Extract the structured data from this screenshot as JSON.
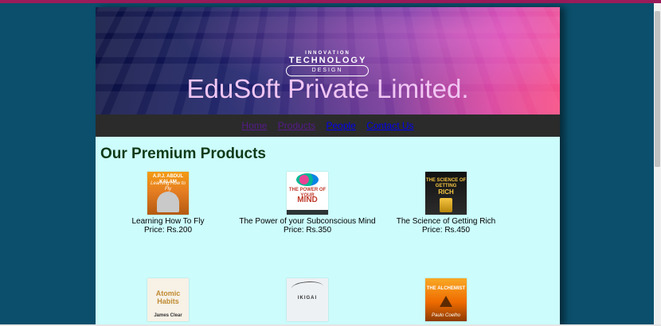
{
  "banner": {
    "small_text": "INNOVATION",
    "technology_text": "TECHNOLOGY",
    "design_text": "DESIGN",
    "title": "EduSoft Private Limited."
  },
  "nav": {
    "items": [
      {
        "label": "Home"
      },
      {
        "label": "Products"
      },
      {
        "label": "People"
      },
      {
        "label": "Contact Us"
      }
    ]
  },
  "section": {
    "heading": "Our Premium Products"
  },
  "products": [
    {
      "name": "Learning How To Fly",
      "price": "Price: Rs.200",
      "cover_title": "A.P.J. ABDUL KALAM",
      "cover_sub": "Learning How to Fly"
    },
    {
      "name": "The Power of your Subconscious Mind",
      "price": "Price: Rs.350",
      "cover_title": "THE POWER OF YOUR",
      "cover_sub": "MIND"
    },
    {
      "name": "The Science of Getting Rich",
      "price": "Price: Rs.450",
      "cover_title": "THE SCIENCE OF GETTING",
      "cover_sub": "RICH"
    },
    {
      "name": "",
      "price": "",
      "cover_title": "Atomic Habits",
      "cover_sub": "James Clear"
    },
    {
      "name": "",
      "price": "",
      "cover_title": "IKIGAI",
      "cover_sub": ""
    },
    {
      "name": "",
      "price": "",
      "cover_title": "THE ALCHEMIST",
      "cover_sub": "Paulo Coelho"
    }
  ],
  "colors": {
    "background": "#0b4f6c",
    "page": "#ccfcfc",
    "navbar": "#2b2b2b",
    "heading": "#0f3a17"
  }
}
